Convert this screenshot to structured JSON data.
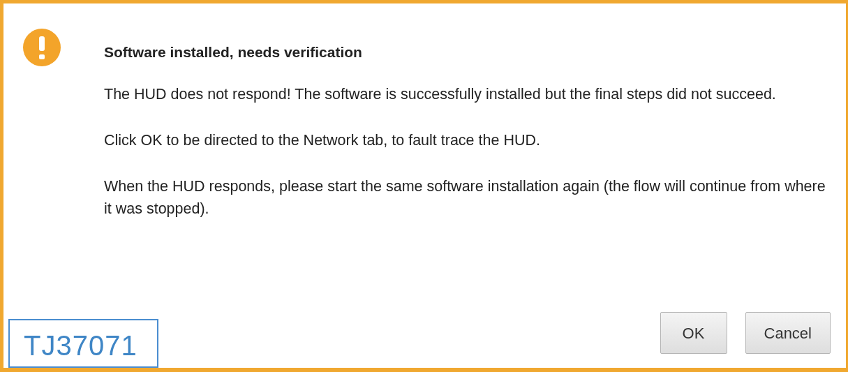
{
  "dialog": {
    "title": "Software installed, needs verification",
    "paragraphs": [
      "The HUD does not respond! The software is successfully installed but the final steps did not succeed.",
      "Click OK to be directed to the Network tab, to fault trace the HUD.",
      "When the HUD responds, please start the same software installation again (the flow will continue from where it was stopped)."
    ],
    "buttons": [
      "OK",
      "Cancel"
    ]
  },
  "figure_label": "TJ37071"
}
